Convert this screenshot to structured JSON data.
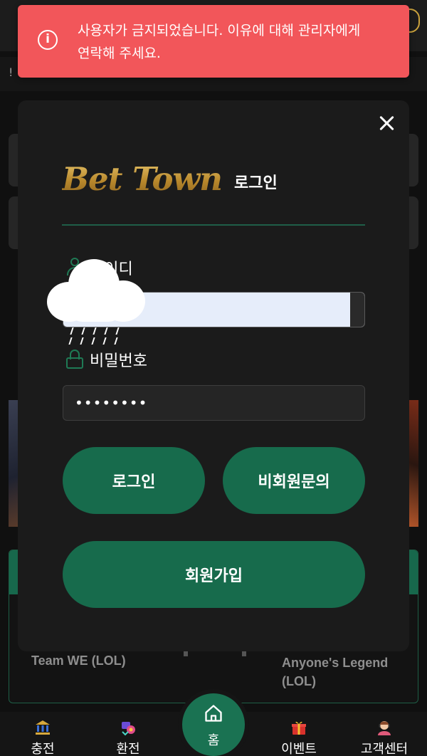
{
  "toast": {
    "message": "사용자가 금지되었습니다. 이유에 대해 관리자에게 연락해 주세요.",
    "icon": "info-icon",
    "color": "#f2565a"
  },
  "background": {
    "match": {
      "team_left": "Team WE (LOL)",
      "team_right": "Anyone's Legend (LOL)"
    }
  },
  "login_modal": {
    "brand": "Bet Town",
    "title_suffix": "로그인",
    "id_field": {
      "label": "아이디",
      "value": ""
    },
    "password_field": {
      "label": "비밀번호",
      "value": "••••••••"
    },
    "buttons": {
      "login": "로그인",
      "guest_inquiry": "비회원문의",
      "signup": "회원가입"
    },
    "accent_color": "#176b4c",
    "brand_color": "#c29a3e"
  },
  "bottom_nav": {
    "items": [
      {
        "label": "충전",
        "icon": "bank-icon"
      },
      {
        "label": "환전",
        "icon": "exchange-icon"
      },
      {
        "label": "홈",
        "icon": "home-icon"
      },
      {
        "label": "이벤트",
        "icon": "gift-icon"
      },
      {
        "label": "고객센터",
        "icon": "support-agent-icon"
      }
    ]
  }
}
